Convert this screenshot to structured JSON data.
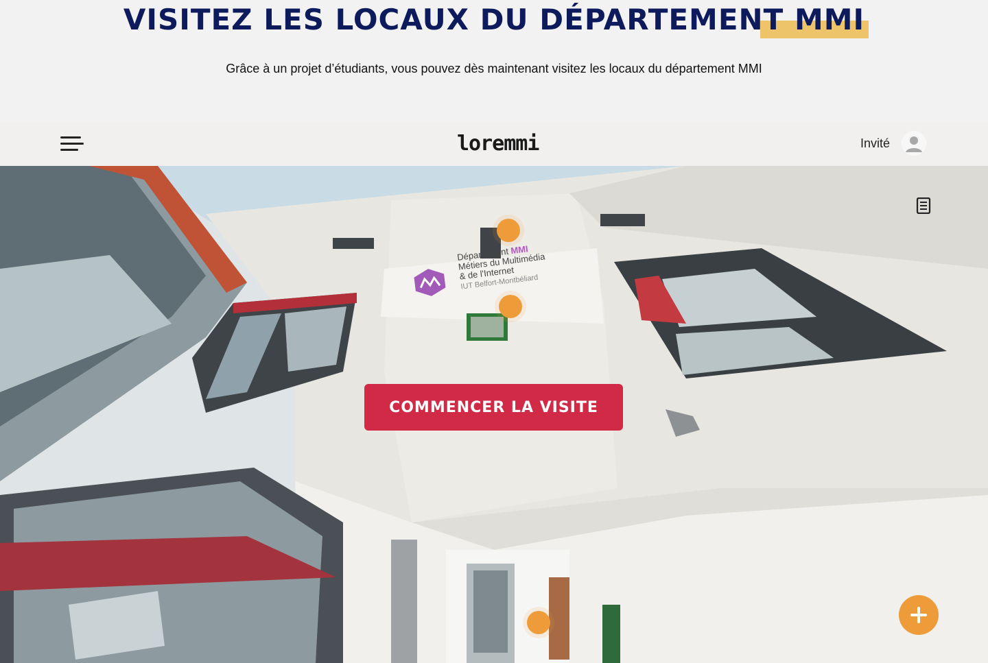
{
  "header": {
    "title": "VISITEZ LES LOCAUX DU DÉPARTEMENT MMI",
    "subtitle": "Grâce à un projet d’étudiants, vous pouvez dès maintenant visitez les locaux du département MMI"
  },
  "viewer": {
    "logo_text": "loremmi",
    "user_label": "Invité",
    "start_button": "COMMENCER LA VISITE",
    "menu_icon": "hamburger-menu-icon",
    "doc_icon": "document-list-icon",
    "fab_icon": "plus-icon",
    "sign": {
      "line1": "Département",
      "line1_accent": "MMI",
      "line2": "Métiers du Multimédia",
      "line3": "& de l'Internet",
      "line4": "IUT Belfort-Montbéliard"
    }
  },
  "colors": {
    "title": "#0d1a5c",
    "title_highlight": "#eec46b",
    "start_button": "#d12a46",
    "hotspot": "#ee9c3a",
    "topbar": "#f1f0ee"
  }
}
